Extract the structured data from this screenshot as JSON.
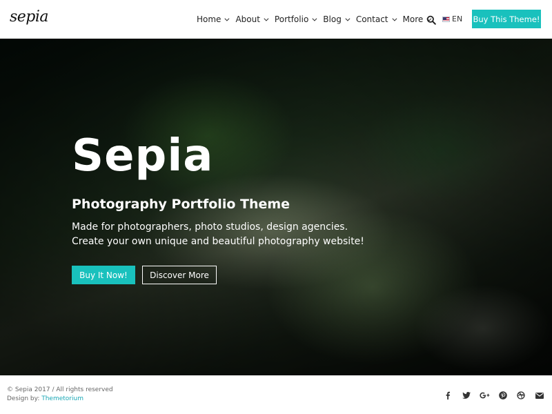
{
  "header": {
    "logo_text": "sepia",
    "nav": [
      {
        "label": "Home"
      },
      {
        "label": "About"
      },
      {
        "label": "Portfolio"
      },
      {
        "label": "Blog"
      },
      {
        "label": "Contact"
      },
      {
        "label": "More"
      }
    ],
    "search_icon": "search-icon",
    "language": "EN",
    "buy_button": "Buy This Theme!"
  },
  "hero": {
    "title": "Sepia",
    "subtitle": "Photography Portfolio Theme",
    "description_line1": "Made for photographers, photo studios, design agencies.",
    "description_line2": "Create your own unique and beautiful photography website!",
    "primary_button": "Buy It Now!",
    "secondary_button": "Discover More"
  },
  "footer": {
    "copyright": "© Sepia 2017 / All rights reserved",
    "credit_prefix": "Design by: ",
    "credit_link": "Themetorium",
    "social": [
      "facebook-icon",
      "twitter-icon",
      "google-plus-icon",
      "pinterest-icon",
      "dribbble-icon",
      "email-icon"
    ]
  },
  "colors": {
    "accent": "#19c1bd",
    "link": "#19a7b5",
    "footer_text": "#666666"
  }
}
